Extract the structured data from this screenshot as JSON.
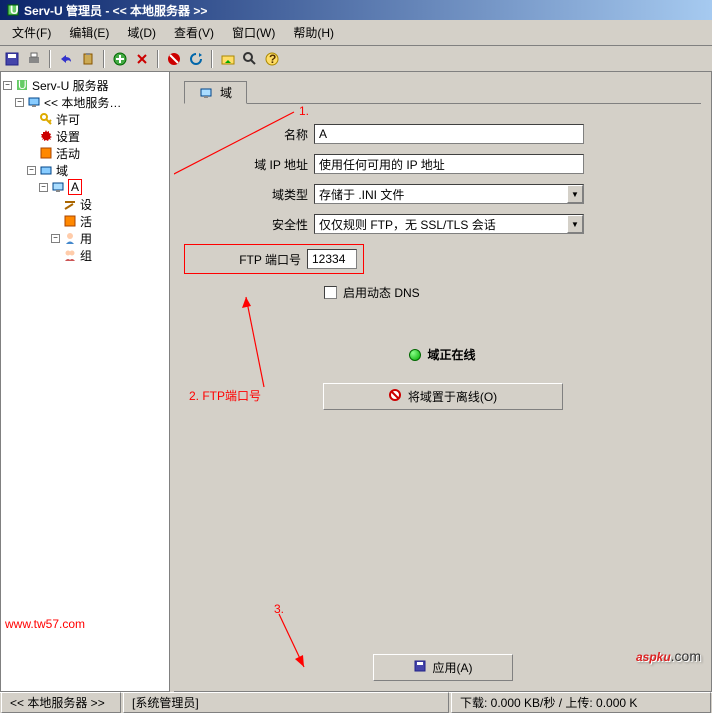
{
  "title": "Serv-U 管理员 - << 本地服务器 >>",
  "menu": {
    "file": "文件(F)",
    "edit": "编辑(E)",
    "domain": "域(D)",
    "view": "查看(V)",
    "window": "窗口(W)",
    "help": "帮助(H)"
  },
  "tree": {
    "root": "Serv-U 服务器",
    "local": "<< 本地服务…",
    "license": "许可",
    "settings": "设置",
    "activity": "活动",
    "domains": "域",
    "domain_a": "A",
    "d_set": "设",
    "d_act": "活",
    "d_users": "用",
    "d_groups": "组"
  },
  "tab": {
    "domain": "域"
  },
  "form": {
    "name_label": "名称",
    "name_value": "A",
    "ip_label": "域 IP 地址",
    "ip_value": "使用任何可用的 IP 地址",
    "type_label": "域类型",
    "type_value": "存储于 .INI 文件",
    "sec_label": "安全性",
    "sec_value": "仅仅规则 FTP，无 SSL/TLS 会话",
    "port_label": "FTP 端口号",
    "port_value": "12334",
    "dns_label": "启用动态 DNS"
  },
  "status": {
    "online": "域正在线"
  },
  "buttons": {
    "offline": "将域置于离线(O)",
    "apply": "应用(A)"
  },
  "annotations": {
    "a1": "1.",
    "a2": "2. FTP端口号",
    "a3": "3."
  },
  "watermark": "www.tw57.com",
  "logo": {
    "name": "aspku",
    "suffix": ".com"
  },
  "statusbar": {
    "p1": "<< 本地服务器 >>",
    "p2": "[系统管理员]",
    "p3": "下载: 0.000 KB/秒 / 上传: 0.000 K"
  }
}
